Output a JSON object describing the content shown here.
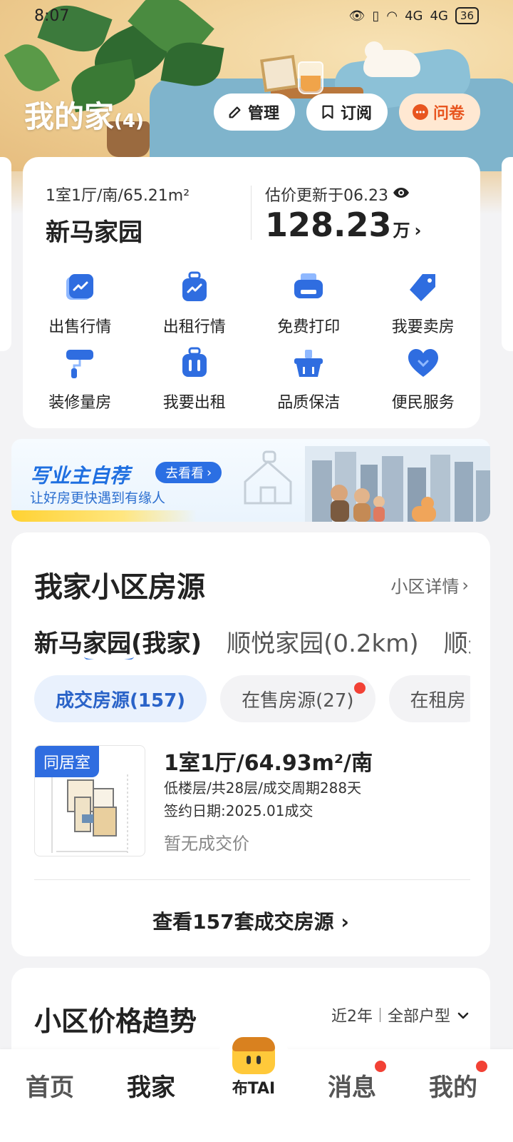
{
  "status": {
    "time": "8:07",
    "signal1": "4G",
    "signal2": "4G",
    "battery": "36"
  },
  "header": {
    "title": "我的家",
    "count": "(4)",
    "buttons": {
      "manage": "管理",
      "subscribe": "订阅",
      "survey": "问卷"
    }
  },
  "home": {
    "meta": "1室1厅/南/65.21m²",
    "name": "新马家园",
    "estimate_label": "估价更新于06.23",
    "estimate_value": "128.23",
    "estimate_unit": "万",
    "services": [
      {
        "label": "出售行情",
        "icon": "trend-chart-icon"
      },
      {
        "label": "出租行情",
        "icon": "rent-suitcase-icon"
      },
      {
        "label": "免费打印",
        "icon": "printer-icon"
      },
      {
        "label": "我要卖房",
        "icon": "price-tag-icon"
      },
      {
        "label": "装修量房",
        "icon": "paint-roller-icon"
      },
      {
        "label": "我要出租",
        "icon": "luggage-icon"
      },
      {
        "label": "品质保洁",
        "icon": "cleaning-basket-icon"
      },
      {
        "label": "便民服务",
        "icon": "heart-icon"
      }
    ]
  },
  "banner": {
    "title": "写业主自荐",
    "button": "去看看",
    "subtitle": "让好房更快遇到有缘人"
  },
  "listings": {
    "title": "我家小区房源",
    "detail_link": "小区详情",
    "community_tabs": [
      "新马家园(我家)",
      "顺悦家园(0.2km)",
      "顺光"
    ],
    "type_tabs": [
      "成交房源(157)",
      "在售房源(27)",
      "在租房"
    ],
    "item": {
      "tag": "同居室",
      "title": "1室1厅/64.93m²/南",
      "meta": "低楼层/共28层/成交周期288天",
      "date": "签约日期:2025.01成交",
      "price": "暂无成交价"
    },
    "view_more": "查看157套成交房源"
  },
  "trend": {
    "title": "小区价格趋势",
    "period": "近2年",
    "room_type": "全部户型"
  },
  "nav": {
    "home": "首页",
    "myhome": "我家",
    "ai": "布TAI",
    "messages": "消息",
    "mine": "我的"
  },
  "colors": {
    "accent": "#2f6de0",
    "survey": "#e8551f",
    "badge": "#f24135"
  }
}
